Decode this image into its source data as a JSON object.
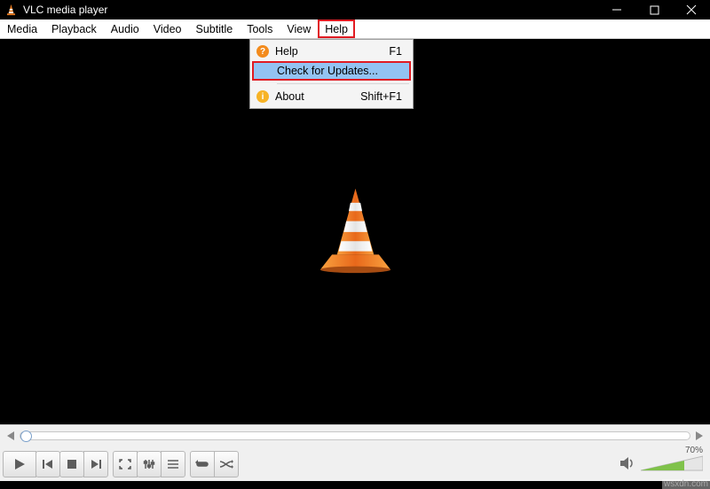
{
  "titlebar": {
    "title": "VLC media player"
  },
  "menubar": {
    "items": [
      {
        "label": "Media"
      },
      {
        "label": "Playback"
      },
      {
        "label": "Audio"
      },
      {
        "label": "Video"
      },
      {
        "label": "Subtitle"
      },
      {
        "label": "Tools"
      },
      {
        "label": "View"
      },
      {
        "label": "Help"
      }
    ]
  },
  "dropdown": {
    "items": [
      {
        "label": "Help",
        "shortcut": "F1"
      },
      {
        "label": "Check for Updates..."
      },
      {
        "label": "About",
        "shortcut": "Shift+F1"
      }
    ]
  },
  "controls": {
    "volume_percent": "70%"
  },
  "watermark": "wsxdn.com"
}
